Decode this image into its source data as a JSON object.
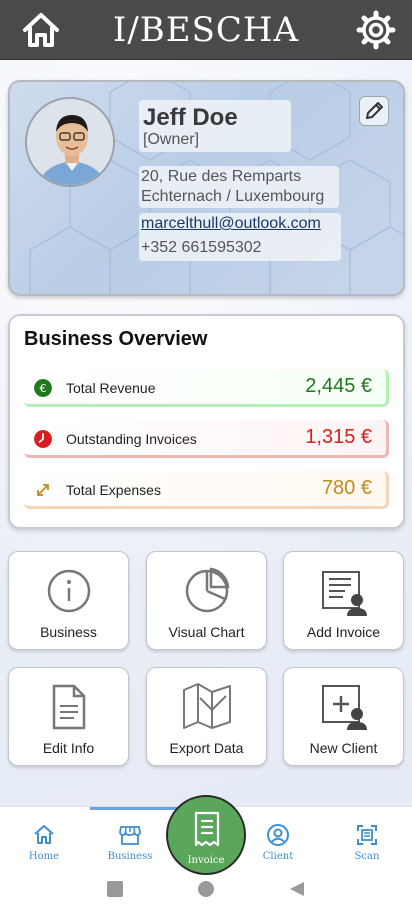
{
  "app": {
    "title": "I/BESCHA"
  },
  "profile": {
    "name": "Jeff Doe",
    "role": "[Owner]",
    "address_line1": "20, Rue des Remparts",
    "address_line2": "Echternach / Luxembourg",
    "email": "marcelthull@outlook.com",
    "phone": "+352 661595302"
  },
  "overview": {
    "title": "Business Overview",
    "rows": [
      {
        "label": "Total Revenue",
        "value": "2,445 €",
        "color": "#1f7a1f",
        "icon": "euro-icon"
      },
      {
        "label": "Outstanding Invoices",
        "value": "1,315 €",
        "color": "#d81e1e",
        "icon": "clock-icon"
      },
      {
        "label": "Total Expenses",
        "value": "780 €",
        "color": "#c28a1c",
        "icon": "arrows-icon"
      }
    ]
  },
  "tiles": [
    {
      "label": "Business",
      "icon": "info-icon"
    },
    {
      "label": "Visual Chart",
      "icon": "pie-chart-icon"
    },
    {
      "label": "Add Invoice",
      "icon": "add-invoice-icon"
    },
    {
      "label": "Edit Info",
      "icon": "document-icon"
    },
    {
      "label": "Export Data",
      "icon": "map-icon"
    },
    {
      "label": "New Client",
      "icon": "add-user-icon"
    }
  ],
  "nav": {
    "items": [
      {
        "label": "Home",
        "icon": "home-icon"
      },
      {
        "label": "Business",
        "icon": "store-icon"
      },
      {
        "label": "Invoice",
        "icon": "receipt-icon"
      },
      {
        "label": "Client",
        "icon": "user-circle-icon"
      },
      {
        "label": "Scan",
        "icon": "scan-icon"
      }
    ],
    "active": "Business"
  },
  "colors": {
    "topbar": "#4a4a4a",
    "accent": "#3d8fd0",
    "fab": "#5aa65a"
  }
}
